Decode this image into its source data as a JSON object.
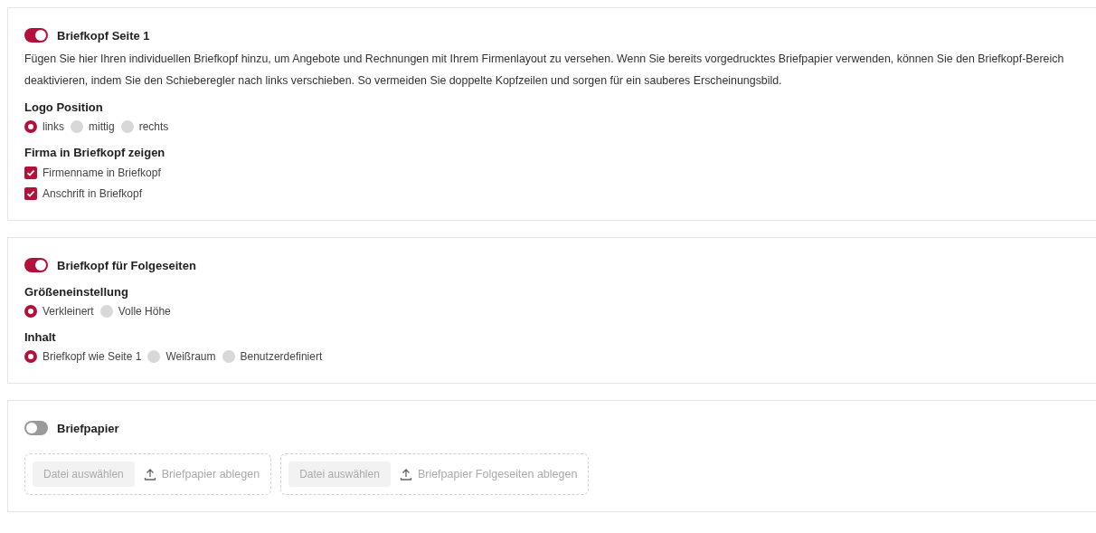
{
  "sections": [
    {
      "title": "Briefkopf Seite 1",
      "on": true,
      "description": "Fügen Sie hier Ihren individuellen Briefkopf hinzu, um Angebote und Rechnungen mit Ihrem Firmenlayout zu versehen. Wenn Sie bereits vorgedrucktes Briefpapier verwenden, können Sie den Briefkopf-Bereich deaktivieren, indem Sie den Schieberegler nach links verschieben. So vermeiden Sie doppelte Kopfzeilen und sorgen für ein sauberes Erscheinungsbild.",
      "groups": [
        {
          "kind": "radio",
          "label": "Logo Position",
          "options": [
            {
              "label": "links",
              "selected": true
            },
            {
              "label": "mittig",
              "selected": false
            },
            {
              "label": "rechts",
              "selected": false
            }
          ]
        },
        {
          "kind": "checkbox",
          "label": "Firma in Briefkopf zeigen",
          "options": [
            {
              "label": "Firmenname in Briefkopf",
              "checked": true
            },
            {
              "label": "Anschrift in Briefkopf",
              "checked": true
            }
          ]
        }
      ]
    },
    {
      "title": "Briefkopf für Folgeseiten",
      "on": true,
      "groups": [
        {
          "kind": "radio",
          "label": "Größeneinstellung",
          "options": [
            {
              "label": "Verkleinert",
              "selected": true
            },
            {
              "label": "Volle Höhe",
              "selected": false
            }
          ]
        },
        {
          "kind": "radio",
          "label": "Inhalt",
          "options": [
            {
              "label": "Briefkopf wie Seite 1",
              "selected": true
            },
            {
              "label": "Weißraum",
              "selected": false
            },
            {
              "label": "Benutzerdefiniert",
              "selected": false
            }
          ]
        }
      ]
    },
    {
      "title": "Briefpapier",
      "on": false,
      "dropzones": [
        {
          "button": "Datei auswählen",
          "hint": "Briefpapier ablegen"
        },
        {
          "button": "Datei auswählen",
          "hint": "Briefpapier Folgeseiten ablegen"
        }
      ]
    }
  ]
}
